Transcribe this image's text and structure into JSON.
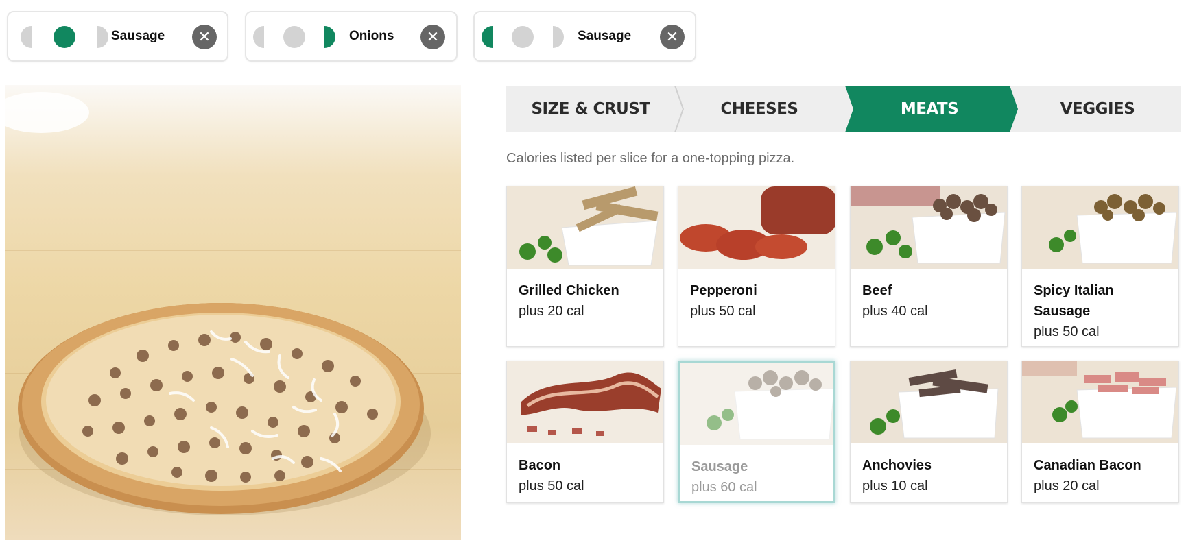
{
  "colors": {
    "accent": "#11875f",
    "chip_inactive": "#d3d3d3",
    "tab_bg": "#eeeeee"
  },
  "selected_toppings": [
    {
      "label": "Sausage",
      "portion": "whole",
      "remove_icon": "close-icon"
    },
    {
      "label": "Onions",
      "portion": "right-half",
      "remove_icon": "close-icon"
    },
    {
      "label": "Sausage",
      "portion": "left-half",
      "remove_icon": "close-icon"
    }
  ],
  "steps": [
    {
      "label": "SIZE & CRUST",
      "active": false
    },
    {
      "label": "CHEESES",
      "active": false
    },
    {
      "label": "MEATS",
      "active": true
    },
    {
      "label": "VEGGIES",
      "active": false
    }
  ],
  "note": "Calories listed per slice for a one-topping pizza.",
  "toppings": [
    {
      "name": "Grilled Chicken",
      "calories": "plus 20 cal",
      "selected": false
    },
    {
      "name": "Pepperoni",
      "calories": "plus 50 cal",
      "selected": false
    },
    {
      "name": "Beef",
      "calories": "plus 40 cal",
      "selected": false
    },
    {
      "name": "Spicy Italian Sausage",
      "calories": "plus 50 cal",
      "selected": false
    },
    {
      "name": "Bacon",
      "calories": "plus 50 cal",
      "selected": false
    },
    {
      "name": "Sausage",
      "calories": "plus 60 cal",
      "selected": true
    },
    {
      "name": "Anchovies",
      "calories": "plus 10 cal",
      "selected": false
    },
    {
      "name": "Canadian Bacon",
      "calories": "plus 20 cal",
      "selected": false
    }
  ]
}
